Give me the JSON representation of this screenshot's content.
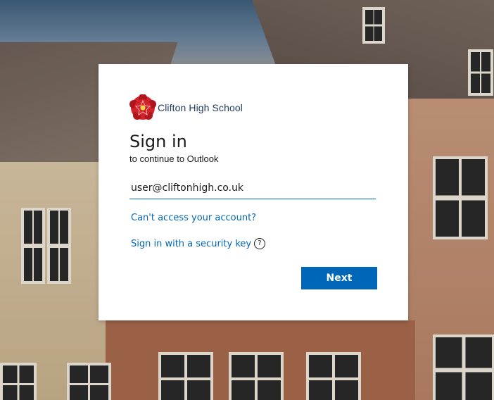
{
  "org": {
    "name": "Clifton High School",
    "logo_icon": "rose-crest-icon"
  },
  "signin": {
    "title": "Sign in",
    "subtitle": "to continue to Outlook",
    "email_value": "user@cliftonhigh.co.uk",
    "cant_access_link": "Can't access your account?",
    "security_key_link": "Sign in with a security key",
    "help_icon": "?",
    "next_button": "Next"
  },
  "colors": {
    "accent": "#0067b8",
    "logo_red": "#d2232a"
  }
}
